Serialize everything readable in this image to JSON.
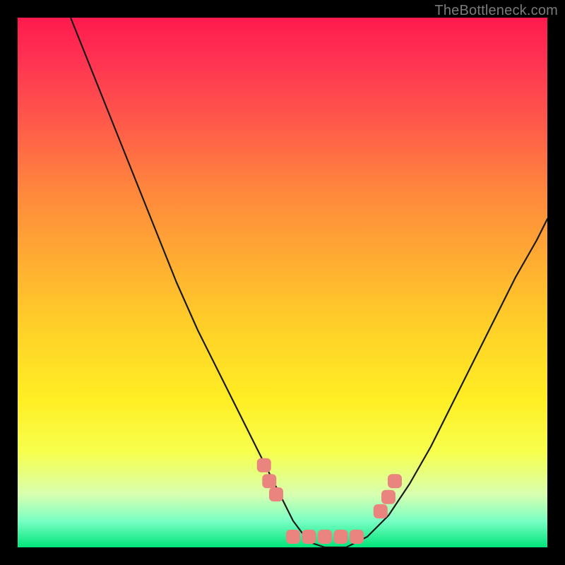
{
  "watermark": "TheBottleneck.com",
  "colors": {
    "curve_stroke": "#1a1a1a",
    "dot_fill": "#e9857e",
    "frame_bg_top": "#ff1a4d",
    "frame_bg_bottom": "#00e57a"
  },
  "chart_data": {
    "type": "line",
    "title": "",
    "xlabel": "",
    "ylabel": "",
    "xlim": [
      0,
      100
    ],
    "ylim": [
      0,
      100
    ],
    "series": [
      {
        "name": "bottleneck-curve",
        "x": [
          10,
          14,
          18,
          22,
          26,
          30,
          34,
          38,
          42,
          46,
          49,
          52,
          55,
          58,
          62,
          66,
          70,
          74,
          78,
          82,
          86,
          90,
          94,
          98,
          100
        ],
        "values": [
          100,
          90,
          80,
          70,
          60,
          50,
          41,
          33,
          25,
          17,
          11,
          5,
          1,
          0,
          0,
          2,
          6,
          12,
          19,
          27,
          35,
          43,
          51,
          58,
          62
        ]
      }
    ],
    "dots": [
      {
        "x": 46.5,
        "y": 15.5
      },
      {
        "x": 47.5,
        "y": 12.5
      },
      {
        "x": 48.8,
        "y": 10.0
      },
      {
        "x": 52.0,
        "y": 2.0
      },
      {
        "x": 55.0,
        "y": 2.0
      },
      {
        "x": 58.0,
        "y": 2.0
      },
      {
        "x": 61.0,
        "y": 2.0
      },
      {
        "x": 64.0,
        "y": 2.0
      },
      {
        "x": 68.5,
        "y": 6.8
      },
      {
        "x": 70.0,
        "y": 9.5
      },
      {
        "x": 71.2,
        "y": 12.5
      }
    ]
  }
}
